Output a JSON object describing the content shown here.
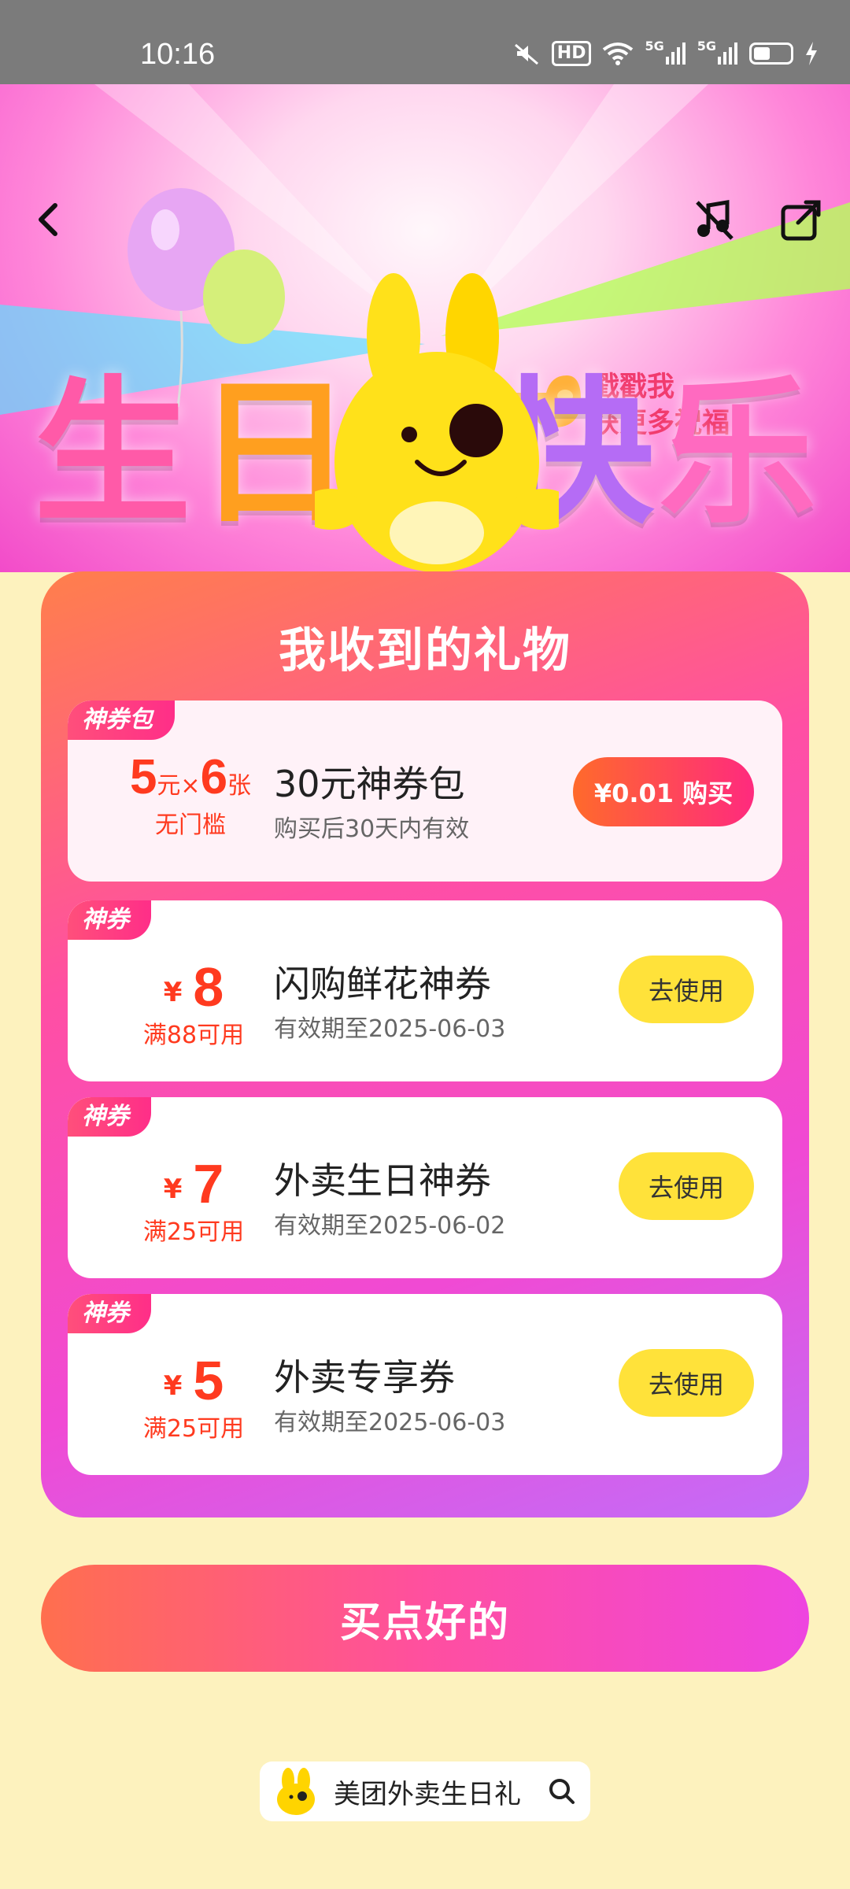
{
  "status_bar": {
    "time": "10:16",
    "hd": "HD",
    "network1": "5G",
    "network2": "5G"
  },
  "hero": {
    "title_chars": [
      "生",
      "日",
      "快",
      "乐"
    ],
    "hint_line1": "戳戳我",
    "hint_line2": "获更多祝福"
  },
  "gift_panel": {
    "title": "我收到的礼物",
    "pack": {
      "tag": "神券包",
      "amount_a": "5",
      "unit_a": "元",
      "times": "×",
      "amount_b": "6",
      "unit_b": "张",
      "condition": "无门槛",
      "name": "30元神券包",
      "desc": "购买后30天内有效",
      "button": "¥0.01 购买"
    },
    "coupons": [
      {
        "tag": "神券",
        "currency": "¥",
        "amount": "8",
        "condition": "满88可用",
        "name": "闪购鲜花神券",
        "validity": "有效期至2025-06-03",
        "button": "去使用"
      },
      {
        "tag": "神券",
        "currency": "¥",
        "amount": "7",
        "condition": "满25可用",
        "name": "外卖生日神券",
        "validity": "有效期至2025-06-02",
        "button": "去使用"
      },
      {
        "tag": "神券",
        "currency": "¥",
        "amount": "5",
        "condition": "满25可用",
        "name": "外卖专享券",
        "validity": "有效期至2025-06-03",
        "button": "去使用"
      }
    ]
  },
  "cta": {
    "label": "买点好的"
  },
  "search": {
    "label": "美团外卖生日礼"
  },
  "icons": [
    "back-icon",
    "music-off-icon",
    "share-icon",
    "search-icon",
    "mascot-icon"
  ]
}
